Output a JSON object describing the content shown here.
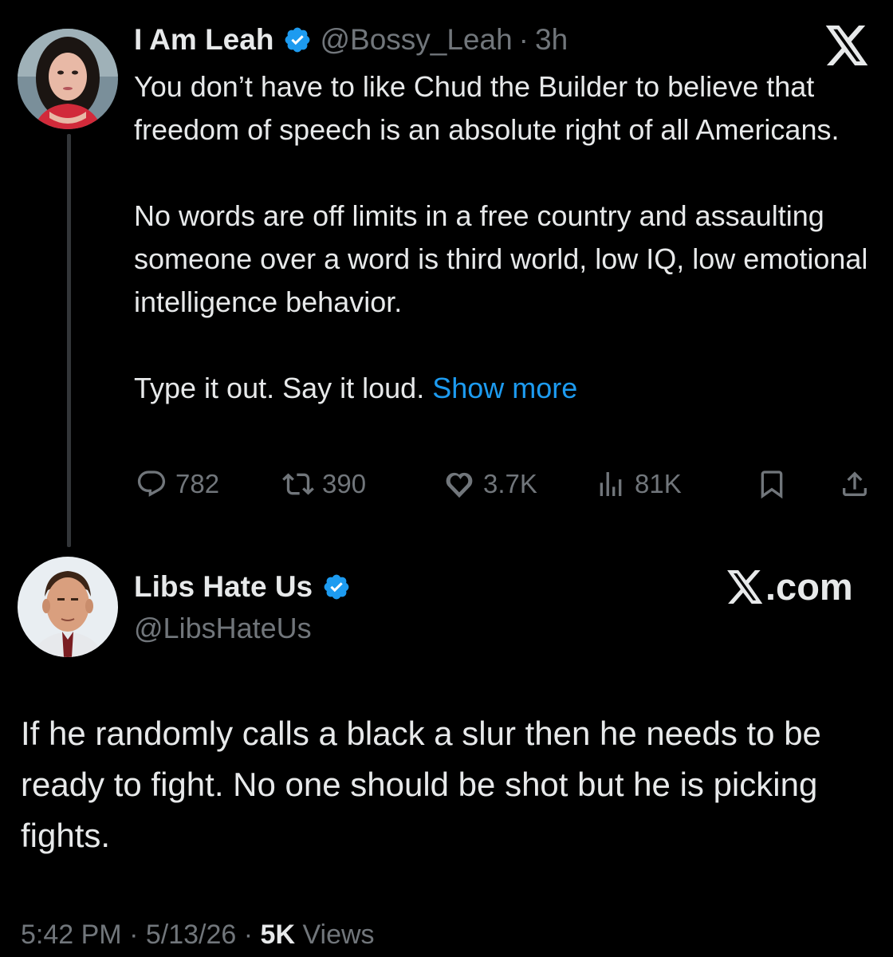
{
  "tweet1": {
    "name": "I Am Leah",
    "handle": "@Bossy_Leah",
    "separator": "·",
    "time": "3h",
    "paragraphs": [
      "You don’t have to like Chud the Builder to believe that freedom of speech is an absolute right of all Americans.",
      "No words are off limits in a free country and assaulting someone over a word is third world, low IQ, low emotional intelligence behavior.",
      "Type it out. Say it loud."
    ],
    "show_more": "Show more",
    "stats": {
      "replies": "782",
      "reposts": "390",
      "likes": "3.7K",
      "views": "81K"
    }
  },
  "tweet2": {
    "name": "Libs Hate Us",
    "handle": "@LibsHateUs",
    "brand": ".com",
    "paragraphs": [
      "If he randomly calls a black a slur then he needs to be ready to fight. No one should be shot but he is picking fights."
    ],
    "time": "5:42 PM",
    "sep1": "·",
    "date": "5/13/26",
    "sep2": "·",
    "views_count": "5K",
    "views_label": "Views"
  },
  "colors": {
    "background": "#000000",
    "text": "#e7e9ea",
    "muted": "#71767b",
    "accent": "#1d9bf0",
    "verified": "#1d9bf0"
  },
  "icons": [
    "verified-badge-icon",
    "x-logo-icon",
    "reply-icon",
    "repost-icon",
    "like-icon",
    "views-icon",
    "bookmark-icon",
    "share-icon"
  ]
}
